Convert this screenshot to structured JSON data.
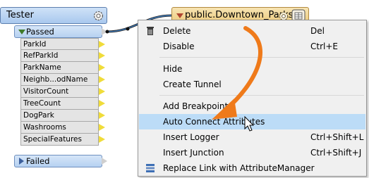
{
  "transformer": {
    "title": "Tester",
    "passed_port": "Passed",
    "failed_port": "Failed",
    "attributes": [
      "ParkId",
      "RefParkId",
      "ParkName",
      "Neighb...odName",
      "VisitorCount",
      "TreeCount",
      "DogPark",
      "Washrooms",
      "SpecialFeatures"
    ]
  },
  "writer": {
    "title": "public.Downtown_Parks"
  },
  "menu": {
    "items": [
      {
        "label": "Delete",
        "shortcut": "Del",
        "icon": "delete-icon"
      },
      {
        "label": "Disable",
        "shortcut": "Ctrl+E"
      },
      {
        "label": "Hide",
        "shortcut": ""
      },
      {
        "label": "Create Tunnel",
        "shortcut": ""
      },
      {
        "label": "Add Breakpoint",
        "shortcut": ""
      },
      {
        "label": "Auto Connect Attributes",
        "shortcut": "",
        "highlighted": true
      },
      {
        "label": "Insert Logger",
        "shortcut": "Ctrl+Shift+L"
      },
      {
        "label": "Insert Junction",
        "shortcut": "Ctrl+Shift+J"
      },
      {
        "label": "Replace Link with AttributeManager",
        "shortcut": "",
        "icon": "attribute-manager-icon"
      }
    ]
  },
  "colors": {
    "highlight": "#bcdcf7",
    "annotation_arrow": "#ef7a1a",
    "connection": "#1a1a1a"
  }
}
